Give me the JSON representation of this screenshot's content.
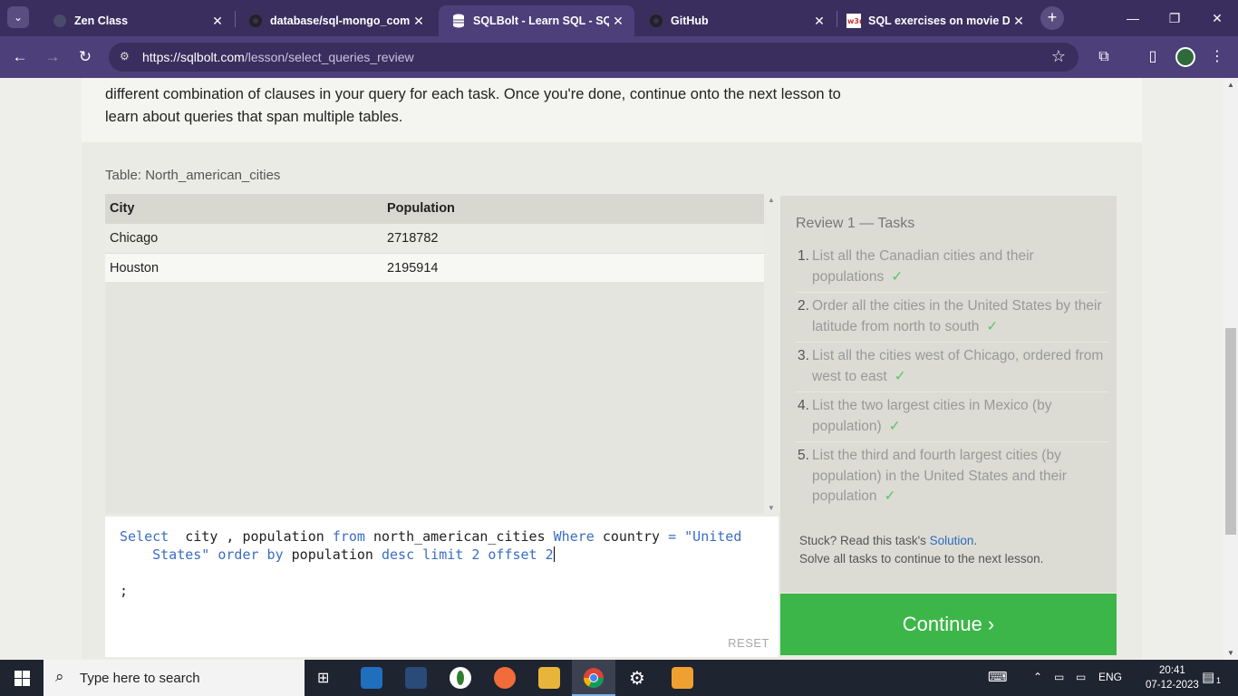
{
  "browser": {
    "tabs": [
      {
        "title": "Zen Class",
        "favicon": "zen-class-icon"
      },
      {
        "title": "database/sql-mongo_comp",
        "favicon": "github-icon"
      },
      {
        "title": "SQLBolt - Learn SQL - SQL F",
        "favicon": "database-icon",
        "active": true
      },
      {
        "title": "GitHub",
        "favicon": "github-icon"
      },
      {
        "title": "SQL exercises on movie Dat",
        "favicon": "w3resource-icon"
      }
    ],
    "url": {
      "host": "https://sqlbolt.com",
      "path": "/lesson/select_queries_review"
    }
  },
  "lesson": {
    "intro_text": "different combination of clauses in your query for each task. Once you're done, continue onto the next lesson to learn about queries that span multiple tables."
  },
  "result_table": {
    "title": "Table: North_american_cities",
    "columns": [
      "City",
      "Population"
    ],
    "rows": [
      [
        "Chicago",
        "2718782"
      ],
      [
        "Houston",
        "2195914"
      ]
    ]
  },
  "editor": {
    "query": "Select  city , population from north_american_cities Where country = \"United States\" order by population desc limit 2 offset 2",
    "terminator": ";",
    "reset_label": "RESET"
  },
  "tasks": {
    "heading": "Review 1 — Tasks",
    "items": [
      {
        "num": "1.",
        "text": "List all the Canadian cities and their populations",
        "done": true
      },
      {
        "num": "2.",
        "text": "Order all the cities in the United States by their latitude from north to south",
        "done": true
      },
      {
        "num": "3.",
        "text": "List all the cities west of Chicago, ordered from west to east",
        "done": true
      },
      {
        "num": "4.",
        "text": "List the two largest cities in Mexico (by population)",
        "done": true
      },
      {
        "num": "5.",
        "text": "List the third and fourth largest cities (by population) in the United States and their population",
        "done": true
      }
    ],
    "check_mark": "✓",
    "stuck_prefix": "Stuck? Read this task's ",
    "solution_link": "Solution",
    "stuck_suffix": ".",
    "solve_note": "Solve all tasks to continue to the next lesson.",
    "continue_label": "Continue ›"
  },
  "taskbar": {
    "search_placeholder": "Type here to search",
    "language": "ENG",
    "time": "20:41",
    "date": "07-12-2023",
    "notification_count": "1"
  }
}
